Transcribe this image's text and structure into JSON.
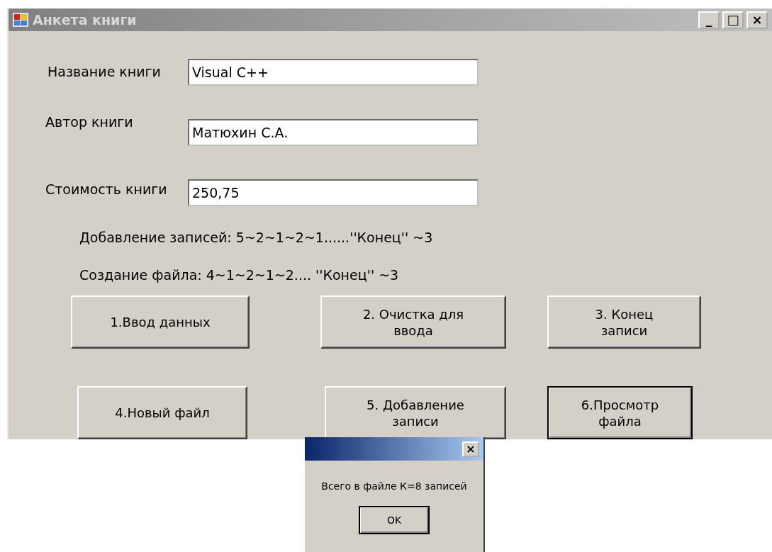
{
  "window": {
    "title": "Анкета книги",
    "controls": [
      "_",
      "□",
      "×"
    ]
  },
  "fields": [
    {
      "label": "Название книги",
      "value": "Visual C++"
    },
    {
      "label": "Автор книги",
      "value": "Матюхин С.А."
    },
    {
      "label": "Стоимость книги",
      "value": "250,75"
    }
  ],
  "hints": [
    "Добавление записей: 5~2~1~2~1......''Конец'' ~3",
    "Создание файла:  4~1~2~1~2.... ''Конец'' ~3"
  ],
  "buttons": [
    {
      "label": "1.Ввод данных",
      "default": false
    },
    {
      "label": "2. Очистка для ввода",
      "default": false
    },
    {
      "label": "3. Конец записи",
      "default": false
    },
    {
      "label": "4.Новый файл",
      "default": false
    },
    {
      "label": "5. Добавление записи",
      "default": false
    },
    {
      "label": "6.Просмотр файла",
      "default": true
    }
  ],
  "message_box": {
    "close": "×",
    "text": "Всего в файле К=8 записей",
    "button": {
      "label": "OK",
      "default": true
    }
  }
}
